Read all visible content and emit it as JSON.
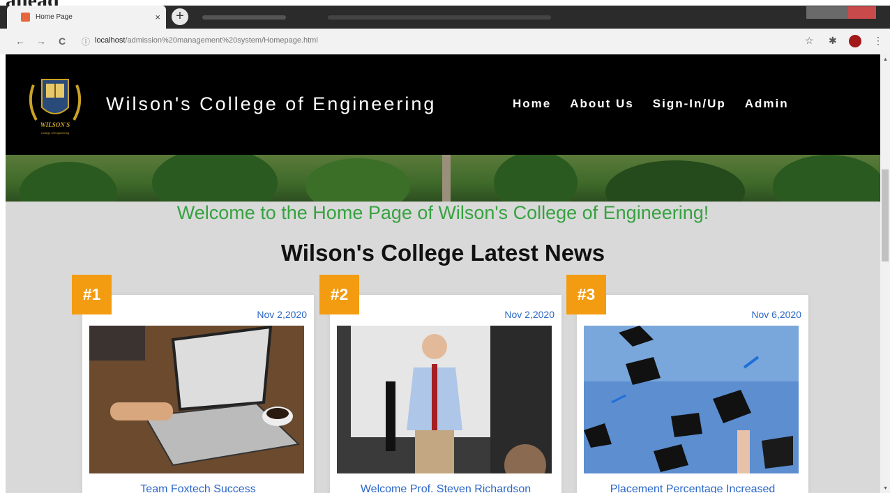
{
  "browser": {
    "tab_title": "Home Page",
    "tab_close": "×",
    "new_tab": "+",
    "url_host": "localhost",
    "url_path": "/admission%20management%20system/Homepage.html",
    "nav_back": "←",
    "nav_forward": "→",
    "nav_reload": "C",
    "info_icon": "ⓘ",
    "star_icon": "☆",
    "extension_icon": "✱",
    "menu_icon": "⋮"
  },
  "site": {
    "title": "Wilson's College of Engineering",
    "nav": [
      "Home",
      "About Us",
      "Sign-In/Up",
      "Admin"
    ],
    "logo": {
      "name": "WILSON'S",
      "subtitle": "College of Engineering"
    }
  },
  "welcome_text": "Welcome to the Home Page of Wilson's College of Engineering!",
  "news_heading": "Wilson's College Latest News",
  "news": [
    {
      "badge": "#1",
      "date": "Nov 2,2020",
      "title": "Team Foxtech Success"
    },
    {
      "badge": "#2",
      "date": "Nov 2,2020",
      "title": "Welcome Prof. Steven Richardson"
    },
    {
      "badge": "#3",
      "date": "Nov 6,2020",
      "title": "Placement Percentage Increased"
    }
  ],
  "colors": {
    "accent_orange": "#f39c12",
    "welcome_green": "#36a240",
    "link_blue": "#2b67c9",
    "header_black": "#000000"
  }
}
